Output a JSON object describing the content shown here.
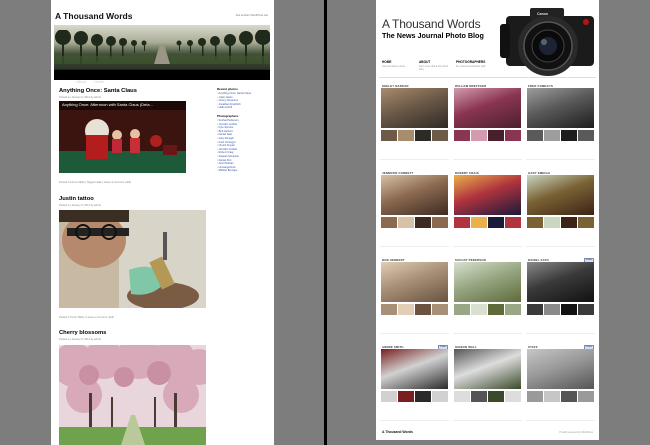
{
  "left": {
    "site_title": "A Thousand Words",
    "site_description": "Just another WordPress site",
    "nav": [
      "Home",
      "About",
      "Home"
    ],
    "posts": [
      {
        "title": "Anything Once: Santa Claus",
        "meta": "Posted on January 9, 2013 by admin",
        "image_caption": "Anything Once: Afternoon with Santa Claus (Deta...",
        "footer": "Posted in Home Slider | Tagged Jake | Leave a comment | Edit"
      },
      {
        "title": "Justin tattoo",
        "meta": "Posted on January 8, 2013 by admin",
        "footer": "Posted in Kevin Slider | Leave a comment | Edit"
      },
      {
        "title": "Cherry blossoms",
        "meta": "Posted on January 8, 2013 by admin"
      }
    ],
    "sidebar": {
      "recent_heading": "Recent photos",
      "recent_items": [
        "Anything Once: Santa Claus",
        "Justin tattoo",
        "Cherry blossoms",
        "Jonathan Froehlich",
        "Hello world!"
      ],
      "photographers_heading": "Photographers",
      "photographers": [
        "Suchat Pederson",
        "Jennifer Corbett",
        "Kyle Somers",
        "Bob Herbert",
        "Daniel Sato",
        "Gary Emeigh",
        "Fred Comegys",
        "Chuck Snyder",
        "Jennifer Corbett",
        "Robert Craig",
        "Saquan Stimpson",
        "Daniel Peri",
        "Scott Nathan",
        "Uncategorized",
        "William Bretzger"
      ]
    }
  },
  "right": {
    "brand": "A Thousand Words",
    "subtitle": "The News Journal Photo Blog",
    "camera_brand": "Canon",
    "nav": [
      {
        "label": "HOME",
        "desc": "view the latest entries"
      },
      {
        "label": "ABOUT",
        "desc": "learn more about this photo blog"
      },
      {
        "label": "PHOTOGRAPHERS",
        "desc": "the news journal photo staff"
      }
    ],
    "tiles": [
      {
        "name": "KEELEY BARKAN",
        "badge": ""
      },
      {
        "name": "WILLIAM BRETZGER",
        "badge": ""
      },
      {
        "name": "FRED COMEGYS",
        "badge": ""
      },
      {
        "name": "JENNIFER CORBETT",
        "badge": ""
      },
      {
        "name": "ROBERT CRAIG",
        "badge": ""
      },
      {
        "name": "GARY EMEIGH",
        "badge": ""
      },
      {
        "name": "BOB HERBERT",
        "badge": ""
      },
      {
        "name": "SUCHAT PEDERSON",
        "badge": ""
      },
      {
        "name": "DANIEL SATO",
        "badge": "Follow"
      },
      {
        "name": "ANDRE SMITH",
        "badge": "Follow"
      },
      {
        "name": "GIDEON WALL",
        "badge": ""
      },
      {
        "name": "STAFF",
        "badge": "Follow"
      }
    ],
    "footer_title": "A Thousand Words",
    "footer_credit": "Proudly powered by WordPress"
  }
}
